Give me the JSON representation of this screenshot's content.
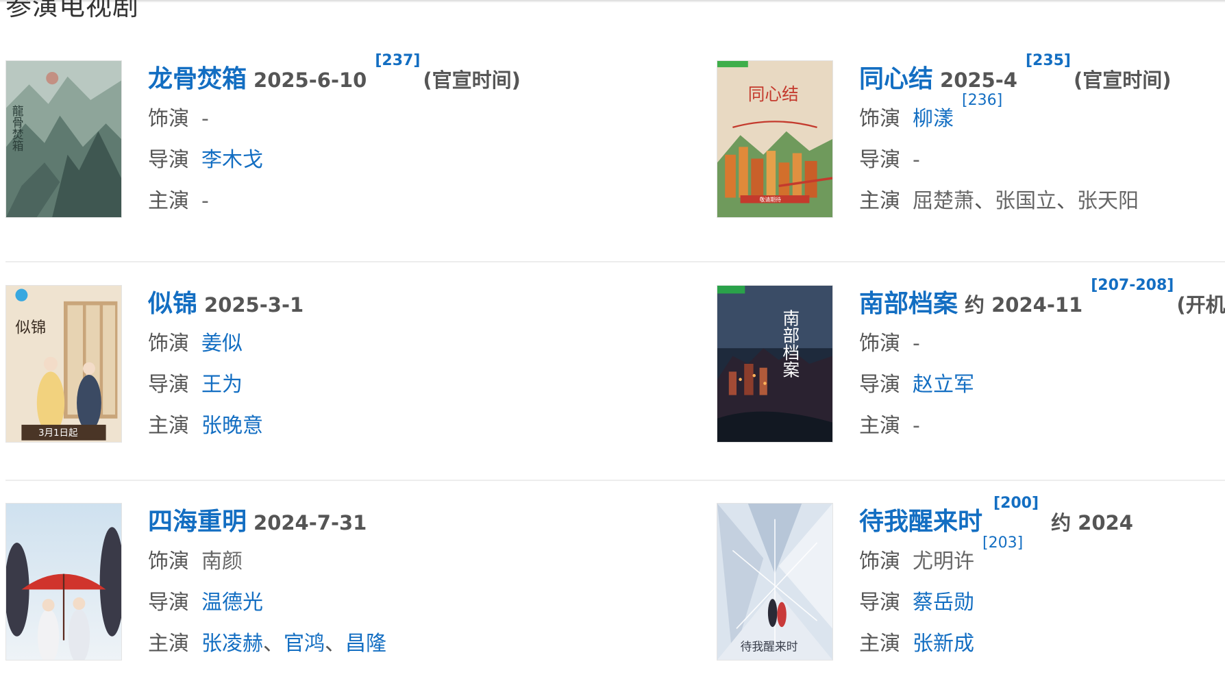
{
  "section_title": "参演电视剧",
  "labels": {
    "role": "饰演",
    "director": "导演",
    "star": "主演"
  },
  "dramas": [
    {
      "title": "龙骨焚箱",
      "date": "2025-6-10",
      "title_ref": "[237]",
      "note": "(官宣时间)",
      "role": "-",
      "role_link": false,
      "role_ref": "",
      "director": "李木戈",
      "director_link": true,
      "stars": [
        "-"
      ],
      "stars_link": false,
      "poster_icon": "ink-landscape-poster"
    },
    {
      "title": "同心结",
      "date": "2025-4",
      "title_ref": "[235]",
      "note": "(官宣时间)",
      "role": "柳漾",
      "role_link": true,
      "role_ref": "[236]",
      "director": "-",
      "director_link": false,
      "stars": [
        "屈楚萧",
        "张国立",
        "张天阳"
      ],
      "stars_link": false,
      "poster_icon": "city-bridge-poster"
    },
    {
      "title": "似锦",
      "date": "2025-3-1",
      "title_ref": "",
      "note": "",
      "role": "姜似",
      "role_link": true,
      "role_ref": "",
      "director": "王为",
      "director_link": true,
      "stars": [
        "张晚意"
      ],
      "stars_link": true,
      "poster_icon": "costume-drama-poster"
    },
    {
      "title": "南部档案",
      "date": "约 2024-11",
      "title_ref": "[207-208]",
      "note": "(开机)",
      "role": "-",
      "role_link": false,
      "role_ref": "",
      "director": "赵立军",
      "director_link": true,
      "stars": [
        "-"
      ],
      "stars_link": false,
      "poster_icon": "night-town-poster"
    },
    {
      "title": "四海重明",
      "date": "2024-7-31",
      "title_ref": "",
      "note": "",
      "role": "南颜",
      "role_link": false,
      "role_ref": "",
      "director": "温德光",
      "director_link": true,
      "stars": [
        "张凌赫",
        "官鸿",
        "昌隆"
      ],
      "stars_link": true,
      "poster_icon": "umbrella-couple-poster"
    },
    {
      "title": "待我醒来时",
      "date": "约 2024",
      "title_ref": "[200]",
      "note": "",
      "role": "尤明许",
      "role_link": false,
      "role_ref": "[203]",
      "director": "蔡岳勋",
      "director_link": true,
      "stars": [
        "张新成"
      ],
      "stars_link": true,
      "poster_icon": "shattered-glass-poster"
    }
  ],
  "poster_texts": {
    "p0": "龍骨焚箱",
    "p1_title": "同心结",
    "p1_banner": "敬请期待",
    "p2_title": "似锦",
    "p2_date": "3月1日起",
    "p3_title": "南部档案",
    "p5_title": "待我醒来时"
  }
}
